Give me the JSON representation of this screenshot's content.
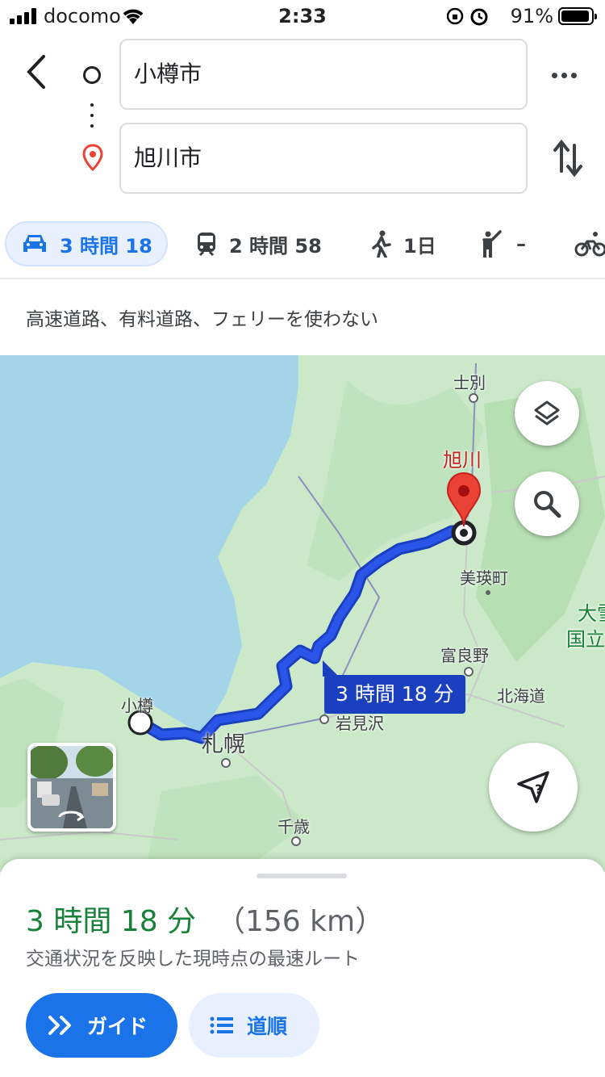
{
  "status_bar": {
    "carrier": "docomo",
    "time": "2:33",
    "battery_percent": "91%"
  },
  "route": {
    "origin_value": "小樽市",
    "destination_value": "旭川市"
  },
  "modes": [
    {
      "mode": "car",
      "label": "3 時間 18",
      "active": true
    },
    {
      "mode": "train",
      "label": "2 時間 58"
    },
    {
      "mode": "walk",
      "label": "1日"
    },
    {
      "mode": "ride",
      "label": "–"
    },
    {
      "mode": "bike",
      "label": ""
    }
  ],
  "options_text": "高速道路、有料道路、フェリーを使わない",
  "map": {
    "labels": {
      "shibetsu": "士別",
      "asahikawa": "旭川",
      "biei": "美瑛町",
      "furano": "富良野",
      "hokkaido_road": "北海道",
      "otaru": "小樽",
      "sapporo": "札幌",
      "iwamizawa": "岩見沢",
      "chitose": "千歳",
      "park_1": "大雪",
      "park_2": "国立"
    },
    "eta_bubble": "3 時間 18 分"
  },
  "sheet": {
    "duration": "3 時間 18 分",
    "distance": "（156 km）",
    "description": "交通状況を反映した現時点の最速ルート",
    "guide_label": "ガイド",
    "steps_label": "道順"
  },
  "colors": {
    "accent": "#1a73e8",
    "route": "#1a3fbf",
    "duration_green": "#188038",
    "pin_red": "#ea4335"
  }
}
